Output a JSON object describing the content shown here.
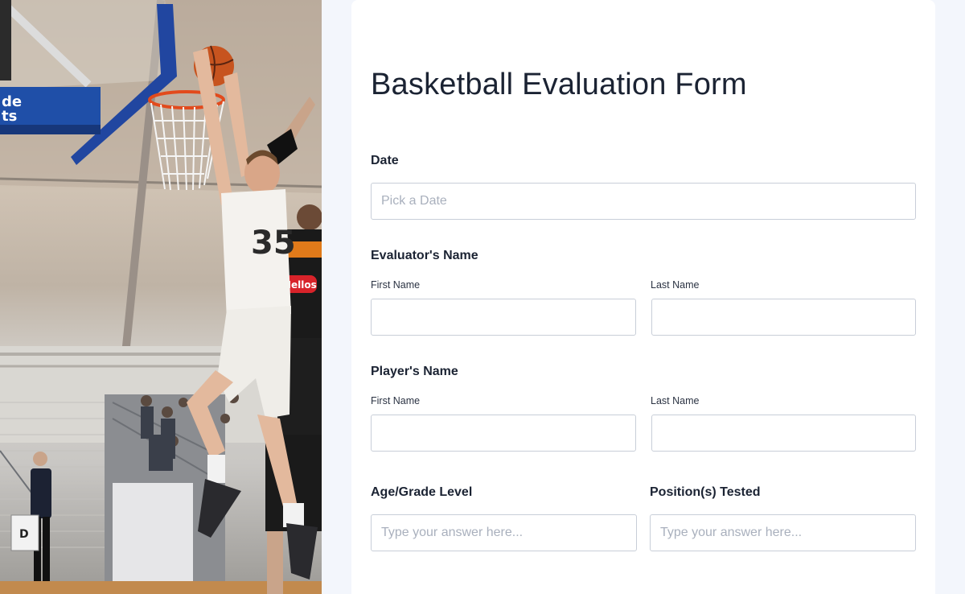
{
  "form": {
    "title": "Basketball Evaluation Form",
    "date": {
      "label": "Date",
      "placeholder": "Pick a Date",
      "value": ""
    },
    "evaluator": {
      "label": "Evaluator's Name",
      "first_label": "First Name",
      "last_label": "Last Name",
      "first_value": "",
      "last_value": ""
    },
    "player": {
      "label": "Player's Name",
      "first_label": "First Name",
      "last_label": "Last Name",
      "first_value": "",
      "last_value": ""
    },
    "age_grade": {
      "label": "Age/Grade Level",
      "placeholder": "Type your answer here...",
      "value": ""
    },
    "positions": {
      "label": "Position(s) Tested",
      "placeholder": "Type your answer here...",
      "value": ""
    }
  },
  "photo": {
    "jersey_number": "35",
    "sponsor_text": "Hellos",
    "backboard_text_1": "de",
    "backboard_text_2": "ts",
    "stand_sign": "D"
  },
  "colors": {
    "page_background": "#f3f6fc",
    "panel_background": "#ffffff",
    "text_primary": "#1b2333",
    "input_border": "#c8ced8",
    "placeholder": "#a9b0bd",
    "backboard_blue": "#1f4fa8"
  }
}
